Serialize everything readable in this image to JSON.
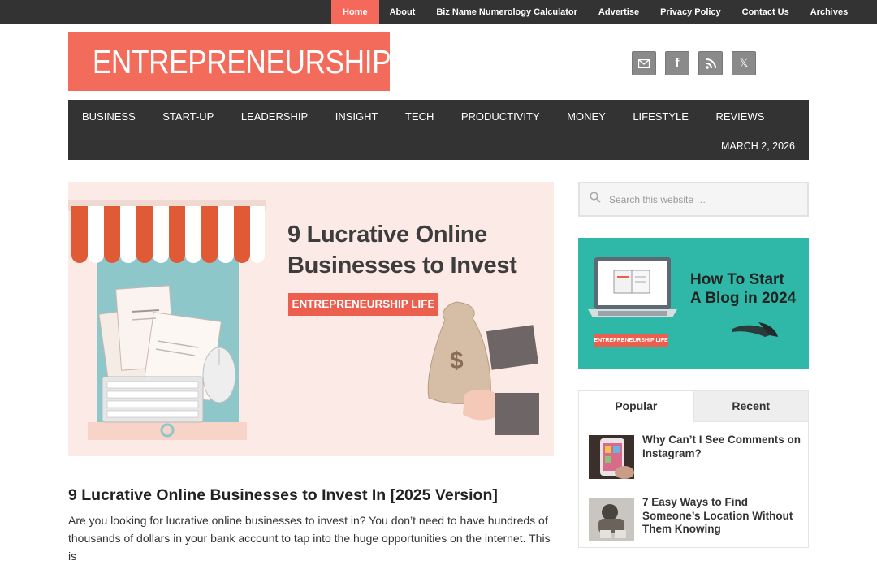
{
  "top_nav": {
    "items": [
      {
        "label": "Home",
        "active": true
      },
      {
        "label": "About"
      },
      {
        "label": "Biz Name Numerology Calculator"
      },
      {
        "label": "Advertise"
      },
      {
        "label": "Privacy Policy"
      },
      {
        "label": "Contact Us"
      },
      {
        "label": "Archives"
      }
    ]
  },
  "header": {
    "logo": "ENTREPRENEURSHIP LIFE",
    "social": [
      {
        "icon": "email-icon",
        "glyph": "✉"
      },
      {
        "icon": "facebook-icon",
        "glyph": "f"
      },
      {
        "icon": "rss-icon",
        "glyph": "◉"
      },
      {
        "icon": "x-icon",
        "glyph": "𝕏"
      }
    ]
  },
  "main_nav": {
    "items": [
      "BUSINESS",
      "START-UP",
      "LEADERSHIP",
      "INSIGHT",
      "TECH",
      "PRODUCTIVITY",
      "MONEY",
      "LIFESTYLE",
      "REVIEWS"
    ],
    "date": "MARCH 2, 2026"
  },
  "featured": {
    "image_title_line1": "9 Lucrative Online",
    "image_title_line2": "Businesses to Invest",
    "image_badge": "ENTREPRENEURSHIP LIFE"
  },
  "post": {
    "title": "9 Lucrative Online Businesses to Invest In [2025 Version]",
    "excerpt": "Are you looking for lucrative online businesses to invest in?  You don’t need to have hundreds of thousands of dollars in your bank account to tap into the huge opportunities on the internet. This is"
  },
  "sidebar": {
    "search_placeholder": "Search this website …",
    "ad_title_line1": "How To Start",
    "ad_title_line2": "A Blog in 2024",
    "ad_badge": "ENTREPRENEURSHIP LIFE",
    "tabs": [
      {
        "label": "Popular",
        "active": true
      },
      {
        "label": "Recent"
      }
    ],
    "popular": [
      {
        "title": "Why Can’t I See Comments on Instagram?"
      },
      {
        "title": "7 Easy Ways to Find Someone’s Location Without Them Knowing"
      }
    ]
  },
  "colors": {
    "accent": "#f26b5b",
    "dark": "#333333",
    "teal": "#2fb8a8"
  }
}
